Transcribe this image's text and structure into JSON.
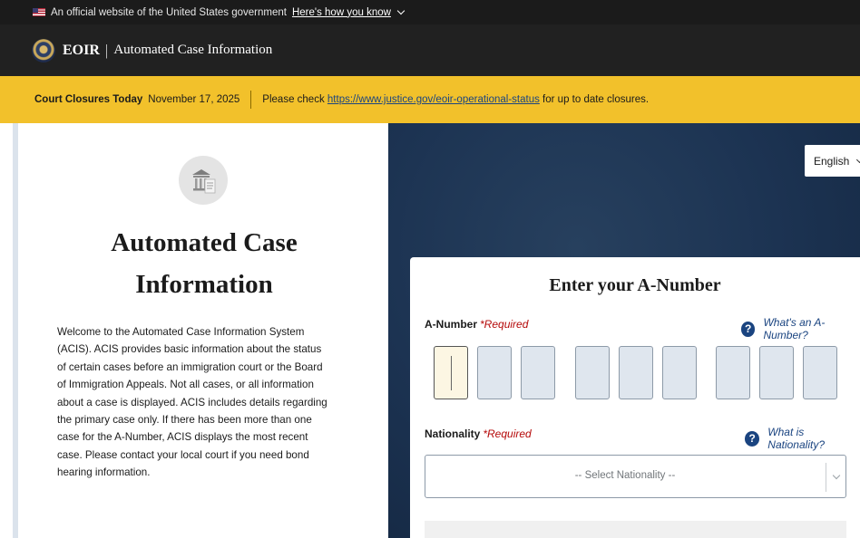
{
  "gov_banner": {
    "text": "An official website of the United States government",
    "link": "Here's how you know"
  },
  "header": {
    "brand": "EOIR",
    "separator": "|",
    "app_name": "Automated Case Information"
  },
  "alert": {
    "label": "Court Closures Today",
    "date": "November 17, 2025",
    "message_prefix": "Please check ",
    "link": "https://www.justice.gov/eoir-operational-status",
    "message_suffix": " for up to date closures."
  },
  "intro": {
    "icon": "courthouse-icon",
    "title": "Automated Case Information",
    "description": "Welcome to the Automated Case Information System (ACIS). ACIS provides basic information about the status of certain cases before an immigration court or the Board of Immigration Appeals. Not all cases, or all information about a case is displayed. ACIS includes details regarding the primary case only. If there has been more than one case for the A-Number, ACIS displays the most recent case. Please contact your local court if you need bond hearing information."
  },
  "language": {
    "selected": "English"
  },
  "form": {
    "title": "Enter your A-Number",
    "a_number": {
      "label": "A-Number",
      "required": "*Required",
      "help": "What's an A-Number?",
      "help_icon": "question-circle-icon",
      "digits": [
        "",
        "",
        "",
        "",
        "",
        "",
        "",
        "",
        ""
      ]
    },
    "nationality": {
      "label": "Nationality",
      "required": "*Required",
      "help": "What is Nationality?",
      "help_icon": "question-circle-icon",
      "placeholder": "-- Select Nationality --"
    }
  }
}
